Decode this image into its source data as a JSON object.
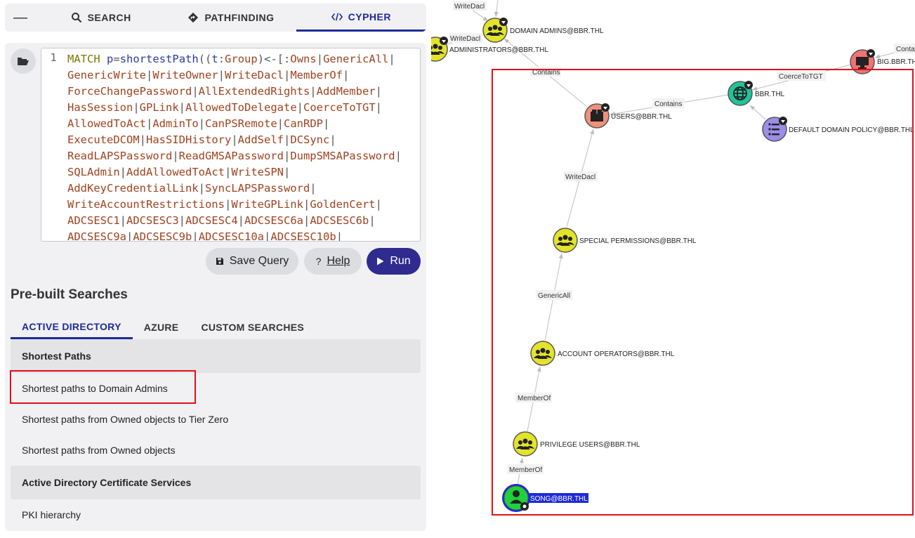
{
  "tabs": {
    "search": "SEARCH",
    "pathfinding": "PATHFINDING",
    "cypher": "CYPHER"
  },
  "editor": {
    "line_number": "1",
    "lines": [
      "MATCH p=shortestPath((t:Group)<-[:Owns|GenericAll|",
      "GenericWrite|WriteOwner|WriteDacl|MemberOf|",
      "ForceChangePassword|AllExtendedRights|AddMember|",
      "HasSession|GPLink|AllowedToDelegate|CoerceToTGT|",
      "AllowedToAct|AdminTo|CanPSRemote|CanRDP|",
      "ExecuteDCOM|HasSIDHistory|AddSelf|DCSync|",
      "ReadLAPSPassword|ReadGMSAPassword|DumpSMSAPassword|",
      "SQLAdmin|AddAllowedToAct|WriteSPN|",
      "AddKeyCredentialLink|SyncLAPSPassword|",
      "WriteAccountRestrictions|WriteGPLink|GoldenCert|",
      "ADCSESC1|ADCSESC3|ADCSESC4|ADCSESC6a|ADCSESC6b|",
      "ADCSESC9a|ADCSESC9b|ADCSESC10a|ADCSESC10b|"
    ]
  },
  "buttons": {
    "save": "Save Query",
    "help": "Help",
    "help_prefix": "?",
    "run": "Run"
  },
  "prebuilt": {
    "title": "Pre-built Searches",
    "tabs": [
      "ACTIVE DIRECTORY",
      "AZURE",
      "CUSTOM SEARCHES"
    ],
    "sections": [
      {
        "header": "Shortest Paths",
        "items": [
          "Shortest paths to Domain Admins",
          "Shortest paths from Owned objects to Tier Zero",
          "Shortest paths from Owned objects"
        ]
      },
      {
        "header": "Active Directory Certificate Services",
        "items": [
          "PKI hierarchy"
        ]
      }
    ]
  },
  "graph": {
    "nodes": {
      "domain_admins": "DOMAIN ADMINS@BBR.THL",
      "administrators": "ADMINISTRATORS@BBR.THL",
      "big": "BIG.BBR.TH",
      "users": "USERS@BBR.THL",
      "bbr": "BBR.THL",
      "default_policy": "DEFAULT DOMAIN POLICY@BBR.THL",
      "special": "SPECIAL PERMISSIONS@BBR.THL",
      "account_ops": "ACCOUNT OPERATORS@BBR.THL",
      "privilege": "PRIVILEGE USERS@BBR.THL",
      "song": "SONG@BBR.THL"
    },
    "edges": {
      "writedacl_top": "WriteDacl",
      "writedacl_admins": "WriteDacl",
      "contains_users_da": "Contains",
      "contains_bbr_users": "Contains",
      "coerce": "CoerceToTGT",
      "contains_big": "Conta",
      "writedacl_special": "WriteDacl",
      "genericall": "GenericAll",
      "memberof_1": "MemberOf",
      "memberof_2": "MemberOf"
    },
    "colors": {
      "group": "#e3e42a",
      "container": "#f0917c",
      "domain": "#20c39a",
      "gpo": "#9c8de6",
      "computer": "#f07373",
      "user": "#1fd13b",
      "selected_label_bg": "#1e2ad6",
      "highlight": "#e0101a"
    }
  }
}
